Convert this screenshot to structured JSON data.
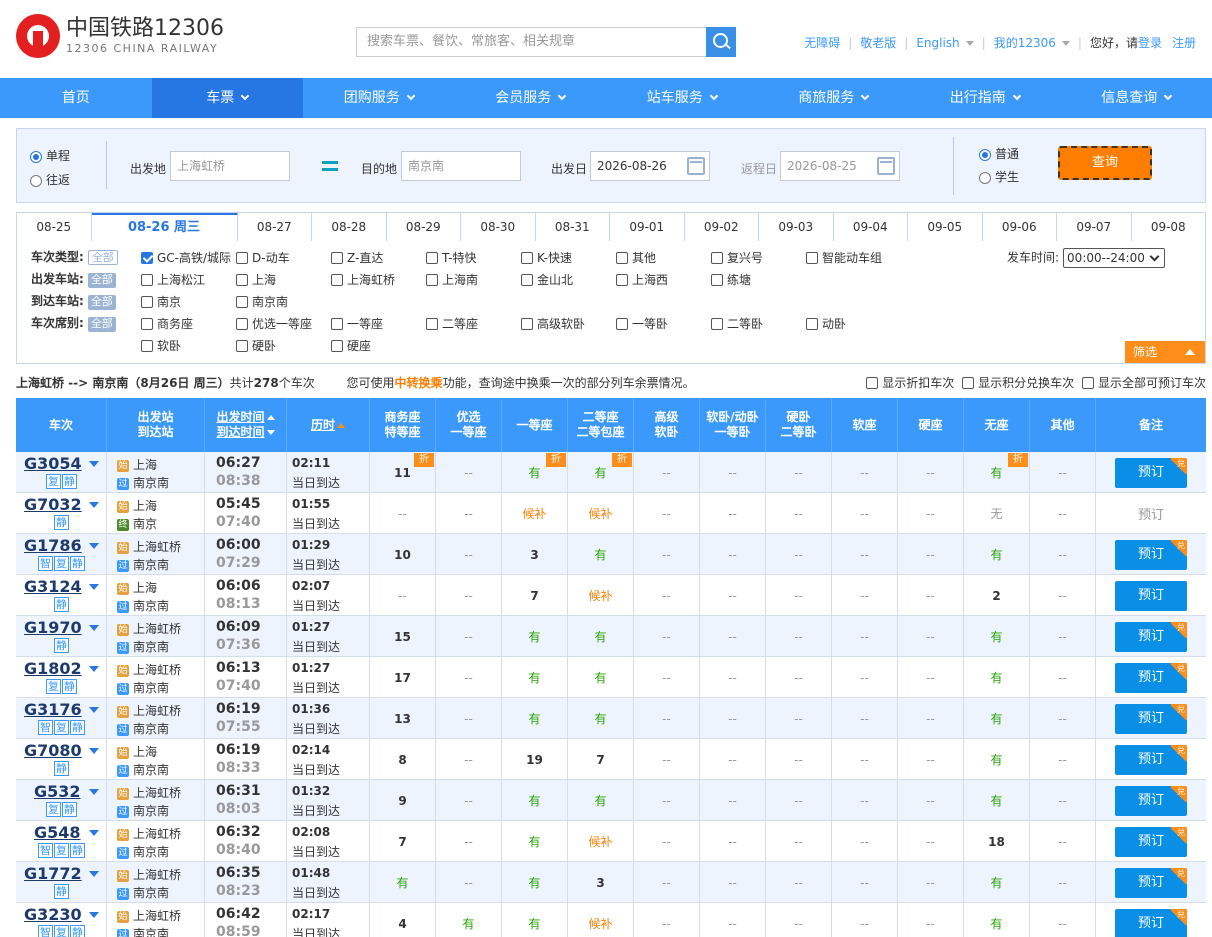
{
  "logo": {
    "cn": "中国铁路12306",
    "en": "12306 CHINA RAILWAY"
  },
  "search": {
    "placeholder": "搜索车票、餐饮、常旅客、相关规章"
  },
  "toplinks": {
    "accessibility": "无障碍",
    "elder": "敬老版",
    "english": "English",
    "my": "我的12306",
    "hello": "您好，请",
    "login": "登录",
    "register": "注册"
  },
  "nav": [
    "首页",
    "车票",
    "团购服务",
    "会员服务",
    "站车服务",
    "商旅服务",
    "出行指南",
    "信息查询"
  ],
  "query": {
    "oneway": "单程",
    "roundtrip": "往返",
    "from_label": "出发地",
    "from_value": "上海虹桥",
    "to_label": "目的地",
    "to_value": "南京南",
    "date_label": "出发日",
    "date_value": "2026-08-26",
    "return_label": "返程日",
    "return_value": "2026-08-25",
    "normal": "普通",
    "student": "学生",
    "submit": "查询"
  },
  "dates": [
    "08-25",
    "08-26 周三",
    "08-27",
    "08-28",
    "08-29",
    "08-30",
    "08-31",
    "09-01",
    "09-02",
    "09-03",
    "09-04",
    "09-05",
    "09-06",
    "09-07",
    "09-08"
  ],
  "filters": {
    "all": "全部",
    "type_label": "车次类型:",
    "types": [
      "GC-高铁/城际",
      "D-动车",
      "Z-直达",
      "T-特快",
      "K-快速",
      "其他",
      "复兴号",
      "智能动车组"
    ],
    "from_label": "出发车站:",
    "from_stations": [
      "上海松江",
      "上海",
      "上海虹桥",
      "上海南",
      "金山北",
      "上海西",
      "练塘"
    ],
    "to_label": "到达车站:",
    "to_stations": [
      "南京",
      "南京南"
    ],
    "seat_label": "车次席别:",
    "seats": [
      "商务座",
      "优选一等座",
      "一等座",
      "二等座",
      "高级软卧",
      "一等卧",
      "二等卧",
      "动卧",
      "软卧",
      "硬卧",
      "硬座"
    ],
    "dep_time_label": "发车时间:",
    "dep_time_value": "00:00--24:00",
    "screen": "筛选"
  },
  "summary": {
    "route": "上海虹桥 --> 南京南（8月26日 周三）",
    "count_pre": "共计",
    "count": "278",
    "count_post": "个车次",
    "tip_pre": "您可使用",
    "tip_em": "中转换乘",
    "tip_post": "功能，查询途中换乘一次的部分列车余票情况。",
    "opt1": "显示折扣车次",
    "opt2": "显示积分兑换车次",
    "opt3": "显示全部可预订车次"
  },
  "table_headers": {
    "train": "车次",
    "stations_1": "出发站",
    "stations_2": "到达站",
    "time_1": "出发时间",
    "time_2": "到达时间",
    "duration": "历时",
    "business_1": "商务座",
    "business_2": "特等座",
    "pref_1": "优选",
    "pref_2": "一等座",
    "first": "一等座",
    "second_1": "二等座",
    "second_2": "二等包座",
    "adv_1": "高级",
    "adv_2": "软卧",
    "soft_1": "软卧/动卧",
    "soft_2": "一等卧",
    "hard_1": "硬卧",
    "hard_2": "二等卧",
    "softseat": "软座",
    "hardseat": "硬座",
    "noseat": "无座",
    "other": "其他",
    "remark": "备注"
  },
  "book_label": "预订",
  "discount_tag": "折",
  "exchange_tag": "兑",
  "same_day": "当日到达",
  "trains": [
    {
      "no": "G3054",
      "badges": [
        "复",
        "静"
      ],
      "from": "上海",
      "from_type": "始",
      "to": "南京南",
      "to_type": "过",
      "dep": "06:27",
      "arr": "08:38",
      "dur": "02:11",
      "biz": "11",
      "pref": "--",
      "first": "有",
      "second": "有",
      "adv": "--",
      "soft": "--",
      "hard": "--",
      "softseat": "--",
      "hardseat": "--",
      "noseat": "有",
      "other": "--",
      "bookable": true,
      "tags": {
        "biz": true,
        "first": true,
        "second": true,
        "noseat": true
      }
    },
    {
      "no": "G7032",
      "badges": [
        "静"
      ],
      "from": "上海",
      "from_type": "始",
      "to": "南京",
      "to_type": "终",
      "dep": "05:45",
      "arr": "07:40",
      "dur": "01:55",
      "biz": "--",
      "pref": "--",
      "first": "候补",
      "second": "候补",
      "adv": "--",
      "soft": "--",
      "hard": "--",
      "softseat": "--",
      "hardseat": "--",
      "noseat": "无",
      "other": "--",
      "bookable": false,
      "tags": {}
    },
    {
      "no": "G1786",
      "badges": [
        "智",
        "复",
        "静"
      ],
      "from": "上海虹桥",
      "from_type": "始",
      "to": "南京南",
      "to_type": "过",
      "dep": "06:00",
      "arr": "07:29",
      "dur": "01:29",
      "biz": "10",
      "pref": "--",
      "first": "3",
      "second": "有",
      "adv": "--",
      "soft": "--",
      "hard": "--",
      "softseat": "--",
      "hardseat": "--",
      "noseat": "有",
      "other": "--",
      "bookable": true,
      "tags": {}
    },
    {
      "no": "G3124",
      "badges": [
        "静"
      ],
      "from": "上海",
      "from_type": "始",
      "to": "南京南",
      "to_type": "过",
      "dep": "06:06",
      "arr": "08:13",
      "dur": "02:07",
      "biz": "--",
      "pref": "--",
      "first": "7",
      "second": "候补",
      "adv": "--",
      "soft": "--",
      "hard": "--",
      "softseat": "--",
      "hardseat": "--",
      "noseat": "2",
      "other": "--",
      "bookable": true,
      "tags": {}
    },
    {
      "no": "G1970",
      "badges": [
        "静"
      ],
      "from": "上海虹桥",
      "from_type": "始",
      "to": "南京南",
      "to_type": "过",
      "dep": "06:09",
      "arr": "07:36",
      "dur": "01:27",
      "biz": "15",
      "pref": "--",
      "first": "有",
      "second": "有",
      "adv": "--",
      "soft": "--",
      "hard": "--",
      "softseat": "--",
      "hardseat": "--",
      "noseat": "有",
      "other": "--",
      "bookable": true,
      "tags": {}
    },
    {
      "no": "G1802",
      "badges": [
        "复",
        "静"
      ],
      "from": "上海虹桥",
      "from_type": "始",
      "to": "南京南",
      "to_type": "过",
      "dep": "06:13",
      "arr": "07:40",
      "dur": "01:27",
      "biz": "17",
      "pref": "--",
      "first": "有",
      "second": "有",
      "adv": "--",
      "soft": "--",
      "hard": "--",
      "softseat": "--",
      "hardseat": "--",
      "noseat": "有",
      "other": "--",
      "bookable": true,
      "tags": {}
    },
    {
      "no": "G3176",
      "badges": [
        "智",
        "复",
        "静"
      ],
      "from": "上海虹桥",
      "from_type": "始",
      "to": "南京南",
      "to_type": "过",
      "dep": "06:19",
      "arr": "07:55",
      "dur": "01:36",
      "biz": "13",
      "pref": "--",
      "first": "有",
      "second": "有",
      "adv": "--",
      "soft": "--",
      "hard": "--",
      "softseat": "--",
      "hardseat": "--",
      "noseat": "有",
      "other": "--",
      "bookable": true,
      "tags": {}
    },
    {
      "no": "G7080",
      "badges": [
        "静"
      ],
      "from": "上海",
      "from_type": "始",
      "to": "南京南",
      "to_type": "过",
      "dep": "06:19",
      "arr": "08:33",
      "dur": "02:14",
      "biz": "8",
      "pref": "--",
      "first": "19",
      "second": "7",
      "adv": "--",
      "soft": "--",
      "hard": "--",
      "softseat": "--",
      "hardseat": "--",
      "noseat": "有",
      "other": "--",
      "bookable": true,
      "tags": {}
    },
    {
      "no": "G532",
      "badges": [
        "复",
        "静"
      ],
      "from": "上海虹桥",
      "from_type": "始",
      "to": "南京南",
      "to_type": "过",
      "dep": "06:31",
      "arr": "08:03",
      "dur": "01:32",
      "biz": "9",
      "pref": "--",
      "first": "有",
      "second": "有",
      "adv": "--",
      "soft": "--",
      "hard": "--",
      "softseat": "--",
      "hardseat": "--",
      "noseat": "有",
      "other": "--",
      "bookable": true,
      "tags": {}
    },
    {
      "no": "G548",
      "badges": [
        "智",
        "复",
        "静"
      ],
      "from": "上海虹桥",
      "from_type": "始",
      "to": "南京南",
      "to_type": "过",
      "dep": "06:32",
      "arr": "08:40",
      "dur": "02:08",
      "biz": "7",
      "pref": "--",
      "first": "有",
      "second": "候补",
      "adv": "--",
      "soft": "--",
      "hard": "--",
      "softseat": "--",
      "hardseat": "--",
      "noseat": "18",
      "other": "--",
      "bookable": true,
      "tags": {}
    },
    {
      "no": "G1772",
      "badges": [
        "静"
      ],
      "from": "上海虹桥",
      "from_type": "始",
      "to": "南京南",
      "to_type": "过",
      "dep": "06:35",
      "arr": "08:23",
      "dur": "01:48",
      "biz": "有",
      "pref": "--",
      "first": "有",
      "second": "3",
      "adv": "--",
      "soft": "--",
      "hard": "--",
      "softseat": "--",
      "hardseat": "--",
      "noseat": "有",
      "other": "--",
      "bookable": true,
      "tags": {}
    },
    {
      "no": "G3230",
      "badges": [
        "智",
        "复",
        "静"
      ],
      "from": "上海虹桥",
      "from_type": "始",
      "to": "南京南",
      "to_type": "过",
      "dep": "06:42",
      "arr": "08:59",
      "dur": "02:17",
      "biz": "4",
      "pref": "有",
      "first": "有",
      "second": "候补",
      "adv": "--",
      "soft": "--",
      "hard": "--",
      "softseat": "--",
      "hardseat": "--",
      "noseat": "有",
      "other": "--",
      "bookable": true,
      "tags": {}
    }
  ],
  "colors": {
    "accent": "#3b99fc",
    "nav_active": "#2676e3",
    "orange": "#ff7e00",
    "green": "#26a306"
  }
}
